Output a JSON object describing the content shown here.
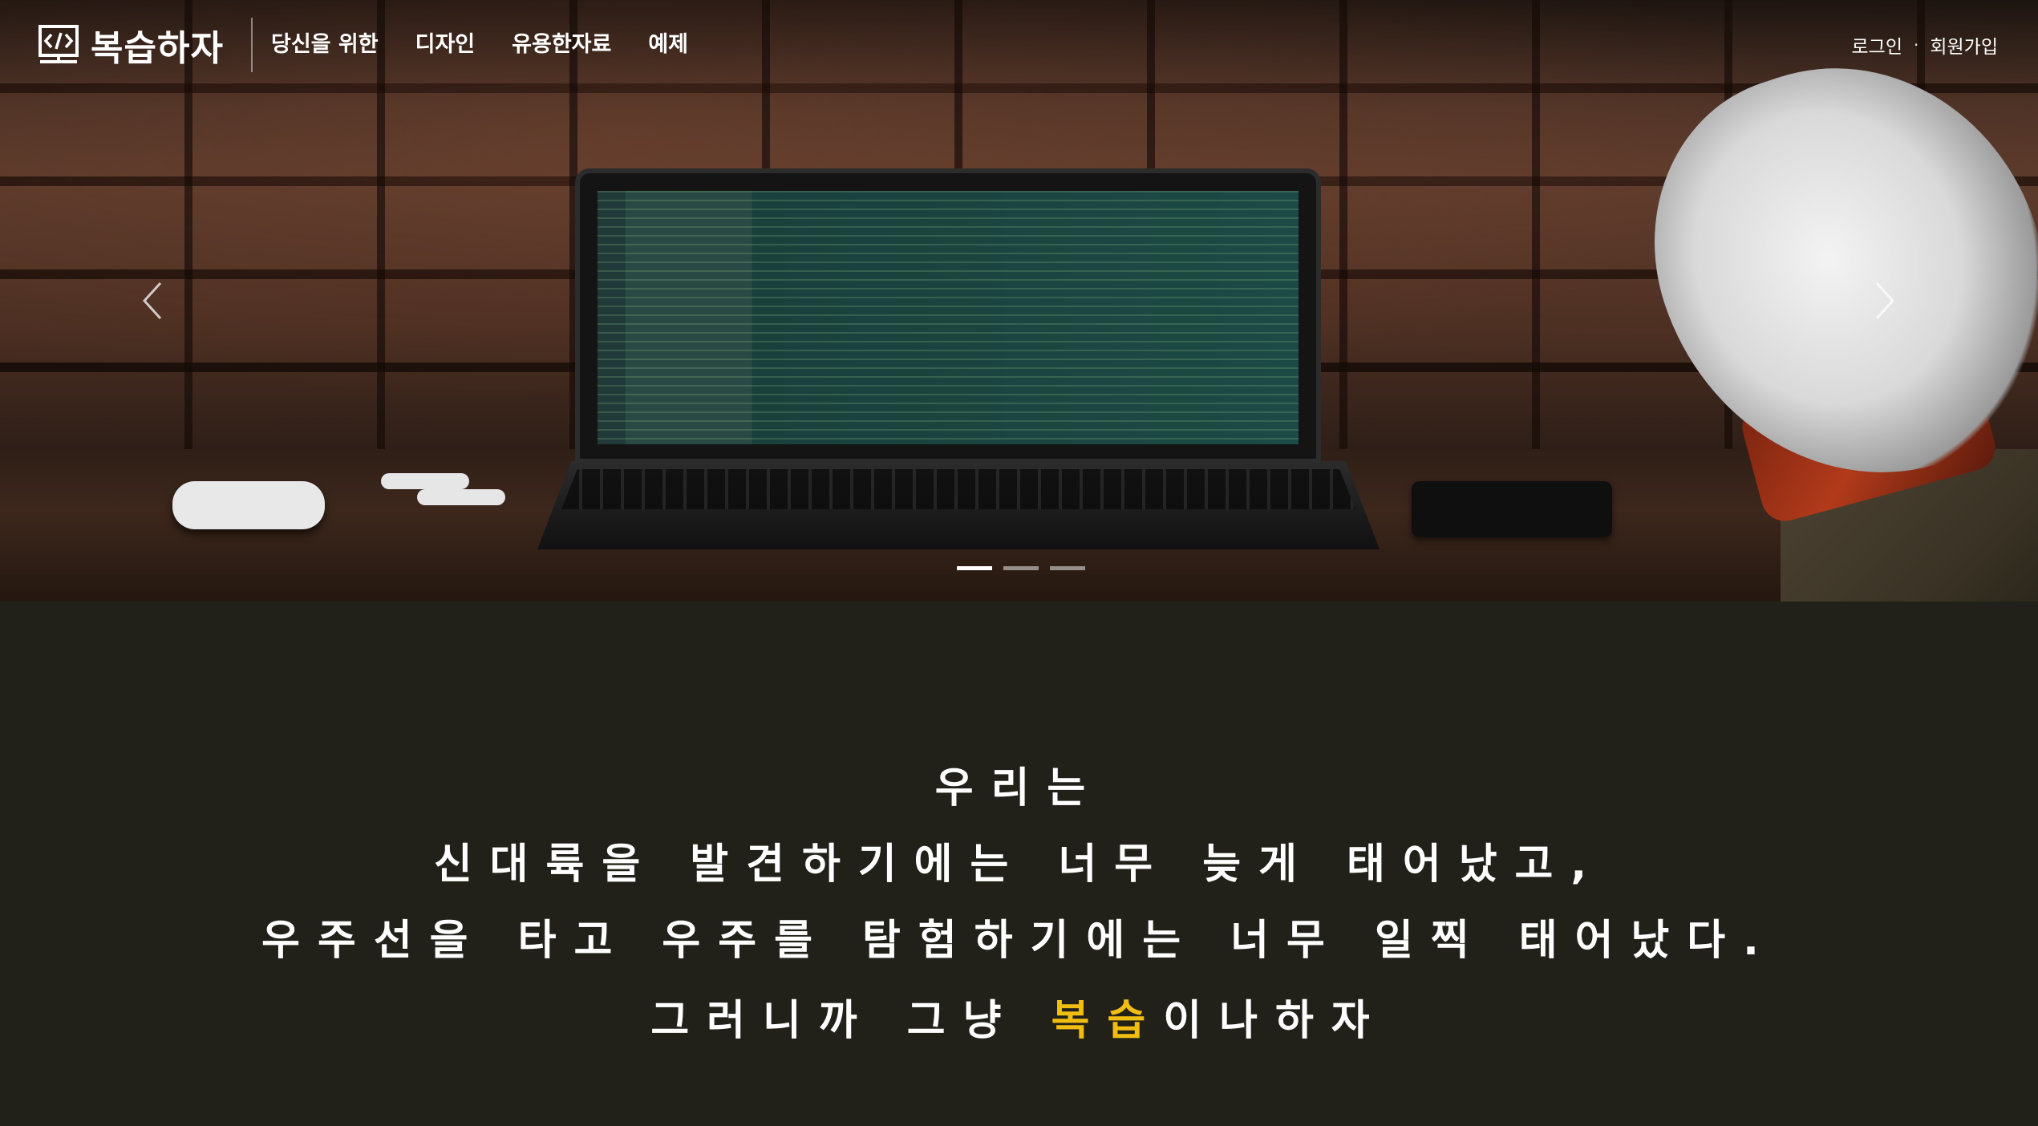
{
  "brand": {
    "name": "복습하자",
    "logo_icon": "code-bracket-icon"
  },
  "nav": {
    "items": [
      {
        "label": "당신을 위한"
      },
      {
        "label": "디자인"
      },
      {
        "label": "유용한자료"
      },
      {
        "label": "예제"
      }
    ]
  },
  "auth": {
    "login": "로그인",
    "separator": "·",
    "signup": "회원가입"
  },
  "carousel": {
    "prev_icon": "chevron-left-icon",
    "next_icon": "chevron-right-icon",
    "slide_count": 3,
    "active_index": 0
  },
  "tagline": {
    "line1": "우리는",
    "line2": "신대륙을 발견하기에는 너무 늦게 태어났고,",
    "line3": "우주선을 타고 우주를 탐험하기에는 너무 일찍 태어났다.",
    "line4_prefix": "그러니까 그냥 ",
    "line4_highlight": "복습",
    "line4_suffix": "이나하자",
    "highlight_color": "#f2bd12"
  }
}
